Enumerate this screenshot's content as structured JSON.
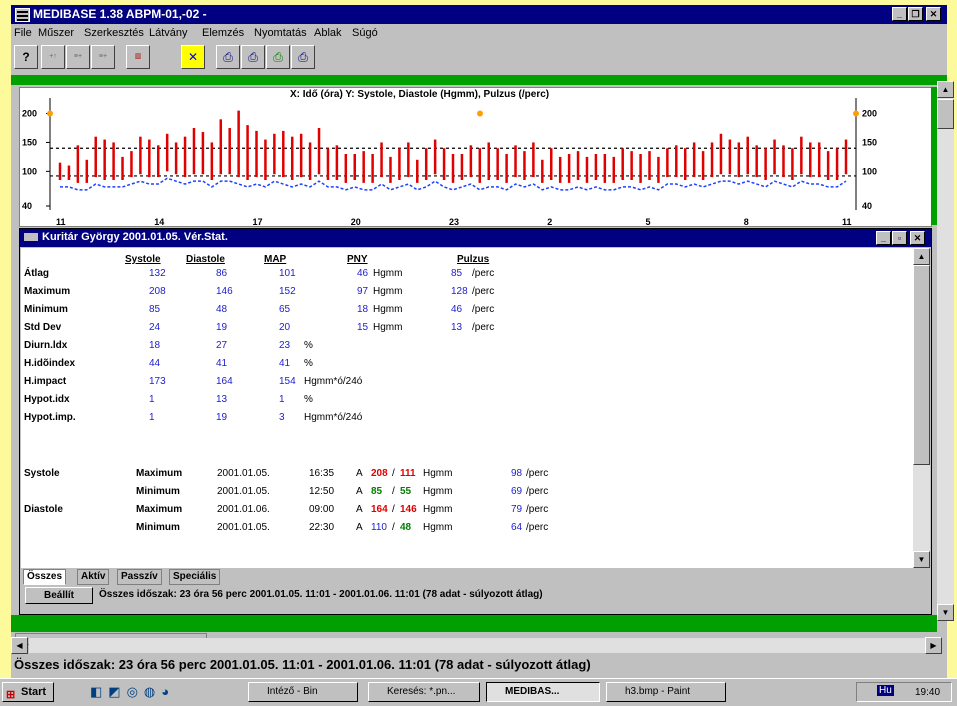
{
  "window": {
    "title": "MEDIBASE 1.38  ABPM-01,-02  -"
  },
  "menu": [
    "File",
    "Műszer",
    "Szerkesztés",
    "Látvány",
    "Elemzés",
    "Nyomtatás",
    "Ablak",
    "Súgó"
  ],
  "toolbar": {
    "labels": [
      "F1",
      "F2",
      "F3",
      "F4",
      "F6",
      "F3",
      "F11",
      "F11"
    ]
  },
  "chart_data": {
    "type": "bar",
    "title": "X: Idő (óra)  Y: Systole, Diastole (Hgmm), Pulzus (/perc)",
    "yticks": [
      "200",
      "150",
      "100",
      "40"
    ],
    "xticks": [
      "11",
      "14",
      "17",
      "20",
      "23",
      "2",
      "5",
      "8",
      "11"
    ],
    "ylim": [
      40,
      220
    ],
    "systole": [
      115,
      110,
      145,
      120,
      160,
      155,
      150,
      125,
      135,
      160,
      155,
      145,
      165,
      150,
      160,
      175,
      168,
      150,
      190,
      175,
      205,
      180,
      170,
      155,
      165,
      170,
      160,
      165,
      150,
      175,
      140,
      145,
      130,
      130,
      135,
      130,
      150,
      125,
      140,
      150,
      120,
      140,
      155,
      140,
      130,
      130,
      145,
      140,
      150,
      140,
      130,
      145,
      135,
      150,
      120,
      140,
      125,
      130,
      135,
      125,
      130,
      130,
      125,
      140,
      135,
      130,
      135,
      125,
      140,
      145,
      140,
      150,
      135,
      150,
      165,
      155,
      150,
      160,
      145,
      140,
      155,
      145,
      140,
      160,
      150,
      150,
      135,
      140,
      155
    ],
    "diastole": [
      85,
      85,
      80,
      80,
      90,
      85,
      85,
      85,
      90,
      95,
      90,
      90,
      100,
      95,
      90,
      95,
      95,
      85,
      95,
      95,
      90,
      85,
      90,
      85,
      95,
      90,
      85,
      90,
      85,
      95,
      85,
      85,
      80,
      85,
      80,
      80,
      90,
      80,
      85,
      90,
      80,
      85,
      95,
      85,
      80,
      85,
      90,
      80,
      85,
      85,
      80,
      90,
      85,
      90,
      80,
      85,
      80,
      80,
      85,
      80,
      85,
      80,
      80,
      85,
      85,
      80,
      85,
      80,
      90,
      90,
      85,
      90,
      85,
      90,
      95,
      95,
      90,
      95,
      90,
      85,
      95,
      90,
      85,
      95,
      90,
      90,
      85,
      85,
      95
    ],
    "guides": [
      140,
      92
    ]
  },
  "subwindow": {
    "title": "Kuritár  György 2001.01.05. Vér.Stat.",
    "headers": [
      "Systole",
      "Diastole",
      "MAP",
      "PNY",
      "Pulzus"
    ],
    "rows": [
      {
        "label": "Átlag",
        "sys": "132",
        "dia": "86",
        "map": "101",
        "pny": "46",
        "pny_unit": "Hgmm",
        "pul": "85",
        "pul_unit": "/perc"
      },
      {
        "label": "Maximum",
        "sys": "208",
        "dia": "146",
        "map": "152",
        "pny": "97",
        "pny_unit": "Hgmm",
        "pul": "128",
        "pul_unit": "/perc"
      },
      {
        "label": "Minimum",
        "sys": "85",
        "dia": "48",
        "map": "65",
        "pny": "18",
        "pny_unit": "Hgmm",
        "pul": "46",
        "pul_unit": "/perc"
      },
      {
        "label": "Std Dev",
        "sys": "24",
        "dia": "19",
        "map": "20",
        "pny": "15",
        "pny_unit": "Hgmm",
        "pul": "13",
        "pul_unit": "/perc"
      },
      {
        "label": "Diurn.ldx",
        "sys": "18",
        "dia": "27",
        "map": "23",
        "map_unit": "%"
      },
      {
        "label": "H.idõindex",
        "sys": "44",
        "dia": "41",
        "map": "41",
        "map_unit": "%"
      },
      {
        "label": "H.impact",
        "sys": "173",
        "dia": "164",
        "map": "154",
        "map_unit": "Hgmm*ó/24ó"
      },
      {
        "label": "Hypot.idx",
        "sys": "1",
        "dia": "13",
        "map": "1",
        "map_unit": "%"
      },
      {
        "label": "Hypot.imp.",
        "sys": "1",
        "dia": "19",
        "map": "3",
        "map_unit": "Hgmm*ó/24ó"
      }
    ],
    "events": [
      {
        "group": "Systole",
        "kind": "Maximum",
        "date": "2001.01.05.",
        "time": "16:35",
        "a": "A",
        "s": "208",
        "d": "111",
        "s_col": "r",
        "d_col": "r",
        "unit": "Hgmm",
        "p": "98",
        "pu": "/perc"
      },
      {
        "group": "",
        "kind": "Minimum",
        "date": "2001.01.05.",
        "time": "12:50",
        "a": "A",
        "s": "85",
        "d": "55",
        "s_col": "g",
        "d_col": "g",
        "unit": "Hgmm",
        "p": "69",
        "pu": "/perc"
      },
      {
        "group": "Diastole",
        "kind": "Maximum",
        "date": "2001.01.06.",
        "time": "09:00",
        "a": "A",
        "s": "164",
        "d": "146",
        "s_col": "r",
        "d_col": "r",
        "unit": "Hgmm",
        "p": "79",
        "pu": "/perc"
      },
      {
        "group": "",
        "kind": "Minimum",
        "date": "2001.01.05.",
        "time": "22:30",
        "a": "A",
        "s": "110",
        "d": "48",
        "s_col": "v",
        "d_col": "g",
        "unit": "Hgmm",
        "p": "64",
        "pu": "/perc"
      }
    ],
    "tabs": [
      "Összes",
      "Aktív",
      "Passzív",
      "Speciális"
    ],
    "setup_button": "Beállít",
    "status": "Összes időszak: 23 óra 56 perc   2001.01.05. 11:01 - 2001.01.06. 11:01  (78 adat - súlyozott átlag)"
  },
  "statusbar": "Összes időszak: 23 óra 56 perc   2001.01.05. 11:01 - 2001.01.06. 11:01  (78 adat - súlyozott átlag)",
  "taskbar": {
    "start": "Start",
    "tasks": [
      "Intéző - Bin",
      "Keresés: *.pn...",
      "MEDIBAS...",
      "h3.bmp - Paint"
    ],
    "lang": "Hu",
    "clock": "19:40"
  }
}
